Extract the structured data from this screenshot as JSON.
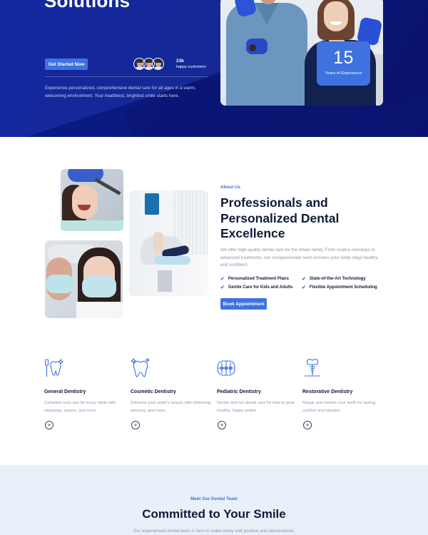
{
  "hero": {
    "title": "Solutions",
    "cta_label": "Get Started Now",
    "customers_count": "23k",
    "customers_label": "happy customers",
    "description": "Experience personalized, comprehensive dental care for all ages in a warm, welcoming environment. Your healthiest, brightest smile starts here.",
    "experience_number": "15",
    "experience_label": "Years of Experience"
  },
  "about": {
    "tag": "About Us",
    "title": "Professionals and Personalized Dental Excellence",
    "description": "We offer high-quality dental care for the whole family. From routine checkups to advanced treatments, our compassionate team ensures your smile stays healthy and confident.",
    "features": [
      "Personalized Treatment Plans",
      "State-of-the-Art Technology",
      "Gentle Care for Kids and Adults",
      "Flexible Appointment Scheduling"
    ],
    "cta_label": "Book Appointment",
    "check_glyph": "✔"
  },
  "services": [
    {
      "icon": "toothbrush-tooth-icon",
      "title": "General Dentistry",
      "description": "Complete oral care for every smile with cleanings, exams, and more."
    },
    {
      "icon": "sparkling-tooth-icon",
      "title": "Cosmetic Dentistry",
      "description": "Enhance your smile's beauty with whitening, veneers, and more."
    },
    {
      "icon": "braces-teeth-icon",
      "title": "Pediatric Dentistry",
      "description": "Gentle and fun dental care for kids to grow healthy, happy smiles."
    },
    {
      "icon": "dental-implant-icon",
      "title": "Restorative Dentistry",
      "description": "Repair and restore your teeth for lasting comfort and function."
    }
  ],
  "plus_glyph": "+",
  "team": {
    "tag": "Meet Our Dental Team",
    "title": "Committed to Your Smile",
    "description": "Our experienced dental team is here to make every visit positive and personalized."
  },
  "colors": {
    "hero_bg": "#0b1a7e",
    "accent": "#3f72e0",
    "heading": "#111a3a",
    "muted_text": "#8f96ab",
    "team_bg": "#eaf0f9"
  }
}
